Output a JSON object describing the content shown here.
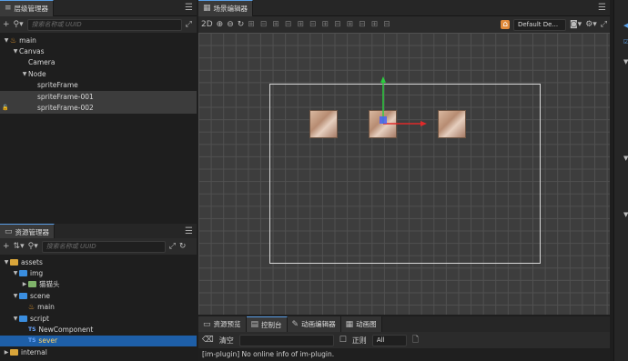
{
  "hierarchy": {
    "title": "层级管理器",
    "search_placeholder": "搜索名称或 UUID",
    "nodes": [
      {
        "label": "main",
        "indent": 0,
        "arrow": "▼",
        "icon": "fire"
      },
      {
        "label": "Canvas",
        "indent": 1,
        "arrow": "▼",
        "icon": ""
      },
      {
        "label": "Camera",
        "indent": 2,
        "arrow": "",
        "icon": ""
      },
      {
        "label": "Node",
        "indent": 2,
        "arrow": "▼",
        "icon": ""
      },
      {
        "label": "spriteFrame",
        "indent": 3,
        "arrow": "",
        "icon": ""
      },
      {
        "label": "spriteFrame-001",
        "indent": 3,
        "arrow": "",
        "icon": ""
      },
      {
        "label": "spriteFrame-002",
        "indent": 3,
        "arrow": "",
        "icon": "",
        "locked": true
      }
    ]
  },
  "assets": {
    "title": "资源管理器",
    "search_placeholder": "搜索名称或 UUID",
    "nodes": [
      {
        "label": "assets",
        "indent": 0,
        "arrow": "▼",
        "icon": "folder-gold"
      },
      {
        "label": "img",
        "indent": 1,
        "arrow": "▼",
        "icon": "folder"
      },
      {
        "label": "猫猫头",
        "indent": 2,
        "arrow": "▶",
        "icon": "image"
      },
      {
        "label": "scene",
        "indent": 1,
        "arrow": "▼",
        "icon": "folder"
      },
      {
        "label": "main",
        "indent": 2,
        "arrow": "",
        "icon": "fire"
      },
      {
        "label": "script",
        "indent": 1,
        "arrow": "▼",
        "icon": "folder"
      },
      {
        "label": "NewComponent",
        "indent": 2,
        "arrow": "",
        "icon": "ts"
      },
      {
        "label": "sever",
        "indent": 2,
        "arrow": "",
        "icon": "ts",
        "selected": true
      },
      {
        "label": "internal",
        "indent": 0,
        "arrow": "▶",
        "icon": "folder-gold"
      }
    ]
  },
  "scene": {
    "title": "场景编辑器",
    "mode_2d": "2D",
    "device": "Default De..."
  },
  "bottom": {
    "tabs": [
      "资源预览",
      "控制台",
      "动画编辑器",
      "动画图"
    ],
    "clear_label": "清空",
    "regex_label": "正则",
    "filter_value": "All",
    "console_line": "[im-plugin] No online info of im-plugin."
  }
}
